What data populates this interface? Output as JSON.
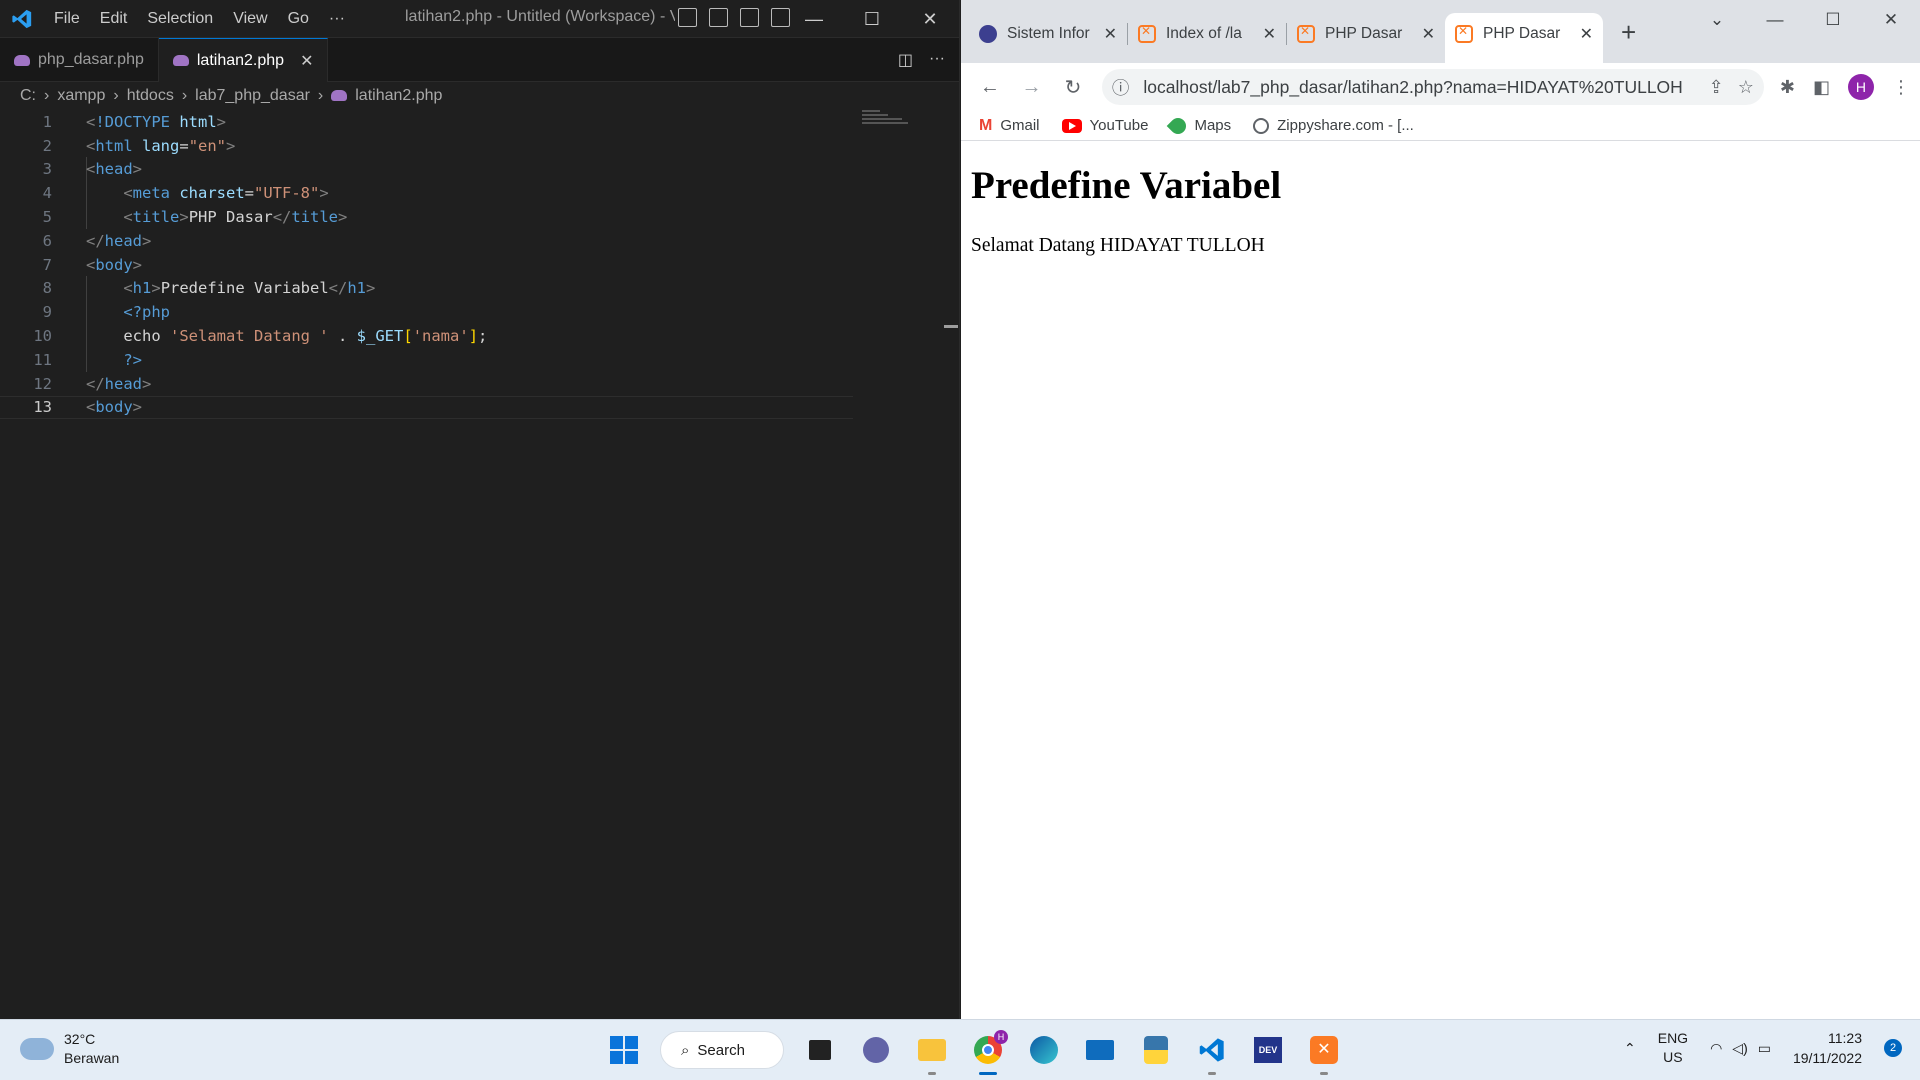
{
  "vscode": {
    "menu": [
      "File",
      "Edit",
      "Selection",
      "View",
      "Go",
      "···"
    ],
    "window_title": "latihan2.php - Untitled (Workspace) - V...",
    "tabs": [
      {
        "label": "php_dasar.php"
      },
      {
        "label": "latihan2.php",
        "close": "✕"
      }
    ],
    "breadcrumb": [
      "C:",
      "xampp",
      "htdocs",
      "lab7_php_dasar",
      "latihan2.php"
    ],
    "line_numbers": [
      "1",
      "2",
      "3",
      "4",
      "5",
      "6",
      "7",
      "8",
      "9",
      "10",
      "11",
      "12",
      "13"
    ],
    "code_lines": [
      "<!DOCTYPE html>",
      "<html lang=\"en\">",
      "<head>",
      "    <meta charset=\"UTF-8\">",
      "    <title>PHP Dasar</title>",
      "</head>",
      "<body>",
      "    <h1>Predefine Variabel</h1>",
      "    <?php",
      "    echo 'Selamat Datang ' . $_GET['nama'];",
      "    ?>",
      "</head>",
      "<body>"
    ],
    "active_line": "13"
  },
  "chrome": {
    "tabs": [
      {
        "label": "Sistem Infor",
        "close": "✕"
      },
      {
        "label": "Index of /la",
        "close": "✕"
      },
      {
        "label": "PHP Dasar",
        "close": "✕"
      },
      {
        "label": "PHP Dasar",
        "close": "✕"
      }
    ],
    "new_tab": "+",
    "url": "localhost/lab7_php_dasar/latihan2.php?nama=HIDAYAT%20TULLOH",
    "avatar_letter": "H",
    "bookmarks": [
      "Gmail",
      "YouTube",
      "Maps",
      "Zippyshare.com - [..."
    ],
    "page": {
      "heading": "Predefine Variabel",
      "text": "Selamat Datang HIDAYAT TULLOH"
    }
  },
  "taskbar": {
    "weather_temp": "32°C",
    "weather_desc": "Berawan",
    "search_label": "Search",
    "lang_1": "ENG",
    "lang_2": "US",
    "time": "11:23",
    "date": "19/11/2022",
    "notif_count": "2",
    "chrome_badge": "H"
  },
  "colors": {
    "vscode_bg": "#1f1f1f",
    "accent": "#0078d4",
    "xampp": "#fb7a24",
    "avatar": "#8e24aa"
  }
}
